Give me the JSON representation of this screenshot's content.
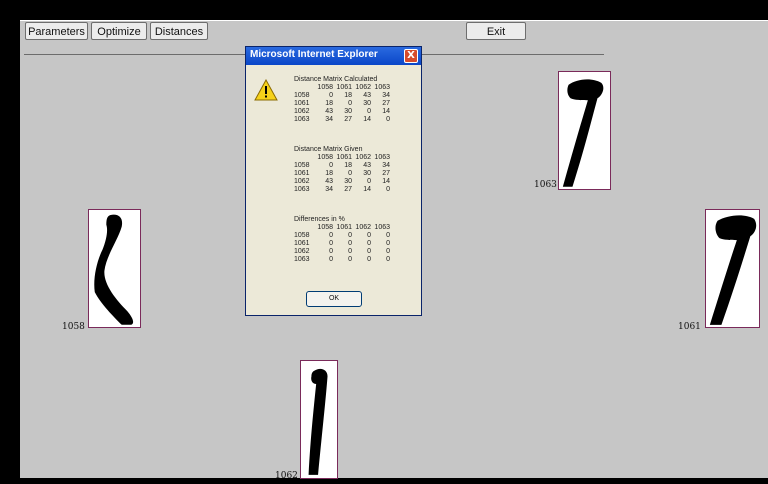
{
  "toolbar": {
    "parameters": "Parameters",
    "optimize": "Optimize",
    "distances": "Distances",
    "exit": "Exit"
  },
  "glyphs": [
    {
      "id": "1058",
      "label": "1058"
    },
    {
      "id": "1061",
      "label": "1061"
    },
    {
      "id": "1062",
      "label": "1062"
    },
    {
      "id": "1063",
      "label": "1063"
    }
  ],
  "dialog": {
    "title": "Microsoft Internet Explorer",
    "close": "X",
    "icon": "warning-icon",
    "ok": "OK",
    "headers": [
      "",
      "1058",
      "1061",
      "1062",
      "1063"
    ],
    "sections": [
      {
        "title": "Distance Matrix Calculated",
        "rows": [
          [
            "1058",
            "0",
            "18",
            "43",
            "34"
          ],
          [
            "1061",
            "18",
            "0",
            "30",
            "27"
          ],
          [
            "1062",
            "43",
            "30",
            "0",
            "14"
          ],
          [
            "1063",
            "34",
            "27",
            "14",
            "0"
          ]
        ]
      },
      {
        "title": "Distance Matrix Given",
        "rows": [
          [
            "1058",
            "0",
            "18",
            "43",
            "34"
          ],
          [
            "1061",
            "18",
            "0",
            "30",
            "27"
          ],
          [
            "1062",
            "43",
            "30",
            "0",
            "14"
          ],
          [
            "1063",
            "34",
            "27",
            "14",
            "0"
          ]
        ]
      },
      {
        "title": "Differences in %",
        "rows": [
          [
            "1058",
            "0",
            "0",
            "0",
            "0"
          ],
          [
            "1061",
            "0",
            "0",
            "0",
            "0"
          ],
          [
            "1062",
            "0",
            "0",
            "0",
            "0"
          ],
          [
            "1063",
            "0",
            "0",
            "0",
            "0"
          ]
        ]
      }
    ]
  },
  "colors": {
    "canvas": "#c6c6c6",
    "title_bar": "#0a46c8",
    "card_border": "#7a2a5a",
    "glyph": "#000000"
  }
}
